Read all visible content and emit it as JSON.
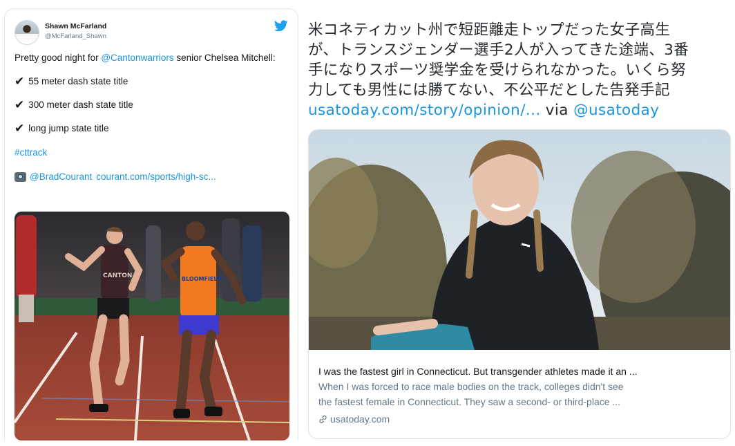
{
  "left_tweet": {
    "display_name": "Shawn McFarland",
    "handle": "@McFarland_Shawn",
    "intro_prefix": "Pretty good night for ",
    "intro_mention": "@Cantonwarriors",
    "intro_suffix": " senior Chelsea Mitchell:",
    "achievements": [
      "55 meter dash state title",
      "300 meter dash state title",
      "long jump state title"
    ],
    "check_symbol": "✔",
    "hashtag": "#cttrack",
    "photo_credit": "@BradCourant",
    "photo_link": "courant.com/sports/high-sc...",
    "jersey_text_1": "CANTON",
    "jersey_text_2": "BLOOMFIELD"
  },
  "right_tweet": {
    "text_lines": [
      "米コネティカット州で短距離走トップだった女子高生",
      "が、トランスジェンダー選手2人が入ってきた途端、3番",
      "手になりスポーツ奨学金を受けられなかった。いくら努",
      "力しても男性には勝てない、不公平だとした告発手記"
    ],
    "link": "usatoday.com/story/opinion/...",
    "via": "via",
    "via_mention": "@usatoday",
    "card": {
      "title": "I was the fastest girl in Connecticut. But transgender athletes made it an ...",
      "description_line_1": "When I was forced to race male bodies on the track, colleges didn't see",
      "description_line_2": "the fastest female in Connecticut. They saw a second- or third-place ...",
      "domain": "usatoday.com"
    }
  },
  "colors": {
    "twitter_blue": "#1b95e0",
    "text_dark": "#14171a",
    "text_grey": "#657786",
    "border": "#e1e8ed",
    "orange_jersey": "#f47a20",
    "maroon_jersey": "#3b2327"
  },
  "icons": {
    "brand": "twitter-bird-icon",
    "check": "check-mark-icon",
    "camera": "camera-icon",
    "link": "link-icon"
  }
}
